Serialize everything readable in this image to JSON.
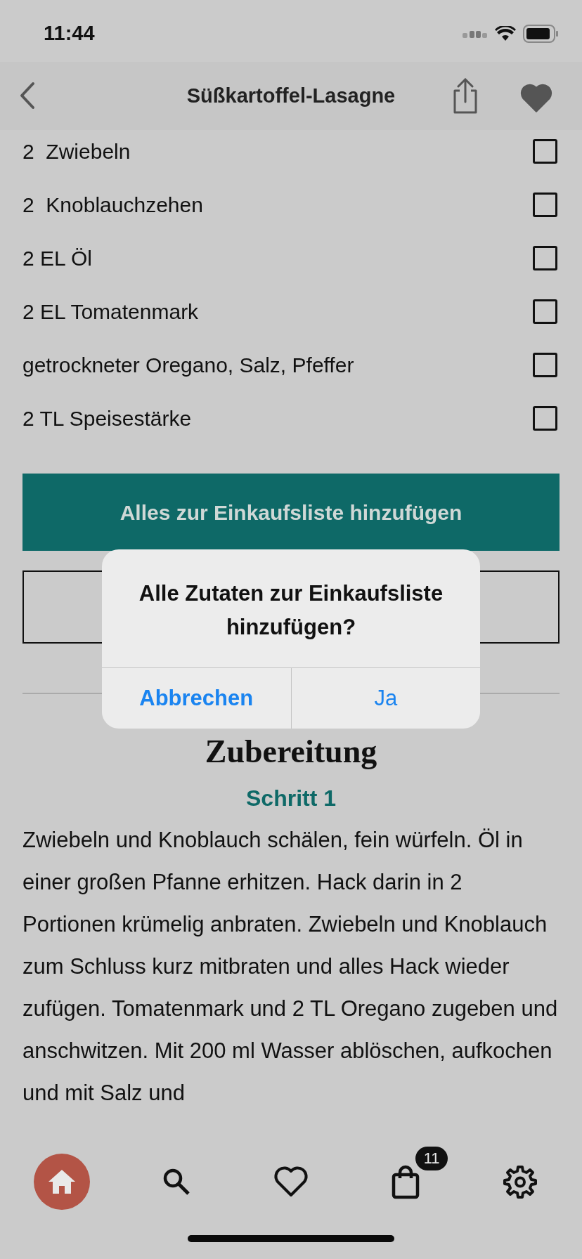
{
  "status_bar": {
    "time": "11:44"
  },
  "nav": {
    "title": "Süßkartoffel-Lasagne",
    "favorite": true
  },
  "ingredients": [
    {
      "text": "2  Zwiebeln",
      "checked": false
    },
    {
      "text": "2  Knoblauchzehen",
      "checked": false
    },
    {
      "text": "2 EL Öl",
      "checked": false
    },
    {
      "text": "2 EL Tomatenmark",
      "checked": false
    },
    {
      "text": "getrockneter Oregano, Salz, Pfeffer",
      "checked": false
    },
    {
      "text": "2 TL Speisestärke",
      "checked": false
    }
  ],
  "add_all_button": "Alles zur Einkaufsliste hinzufügen",
  "preparation": {
    "heading": "Zubereitung",
    "steps": [
      {
        "title": "Schritt 1",
        "text": "Zwiebeln und Knoblauch schälen, fein würfeln. Öl in einer großen Pfanne erhitzen. Hack darin in 2 Portionen krümelig anbraten. Zwiebeln und Knoblauch zum Schluss kurz mitbraten und alles Hack wieder zufügen. Tomatenmark und 2 TL Oregano zugeben und anschwitzen. Mit 200 ml Wasser ablöschen, aufkochen und mit Salz und"
      }
    ]
  },
  "tab_bar": {
    "items": [
      {
        "kind": "home",
        "selected": true
      },
      {
        "kind": "search",
        "selected": false
      },
      {
        "kind": "favorites",
        "selected": false
      },
      {
        "kind": "cart",
        "selected": false,
        "badge": "11"
      },
      {
        "kind": "settings",
        "selected": false
      }
    ]
  },
  "dialog": {
    "message": "Alle Zutaten zur Einkaufsliste hinzufügen?",
    "buttons": [
      {
        "label": "Abbrechen",
        "bold": true
      },
      {
        "label": "Ja",
        "bold": false
      }
    ]
  }
}
